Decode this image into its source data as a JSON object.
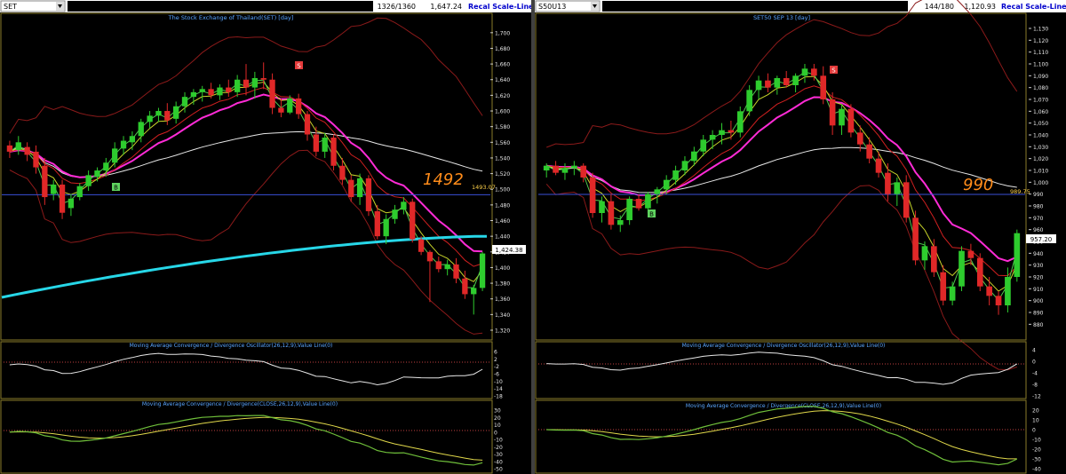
{
  "panels": [
    {
      "id": "left",
      "symbol": "SET",
      "counter": "1326/1360",
      "last_value": "1,647.24",
      "scale_button": "Recal Scale-Linear",
      "main_title": "The Stock Exchange of Thailand(SET) [day]",
      "annotation": "1492",
      "hline_label": "1493.07",
      "last_price_label": "1,424.38",
      "buy_marker": "B",
      "sell_marker": "S",
      "y_ticks": [
        "1,700",
        "1,680",
        "1,660",
        "1,640",
        "1,620",
        "1,600",
        "1,580",
        "1,560",
        "1,540",
        "1,520",
        "1,500",
        "1,480",
        "1,460",
        "1,440",
        "1,420",
        "1,400",
        "1,380",
        "1,360",
        "1,340",
        "1,320"
      ],
      "osc_title": "Moving Average Convergence / Divergence Oscillator(26,12,9),Value Line(0)",
      "osc_ticks": [
        "6",
        "2",
        "-2",
        "-6",
        "-10",
        "-14",
        "-18"
      ],
      "macd_title": "Moving Average Convergence / Divergence(CLOSE,26,12,9),Value Line(0)",
      "macd_ticks": [
        "30",
        "20",
        "10",
        "0",
        "-10",
        "-20",
        "-30",
        "-40",
        "-50"
      ]
    },
    {
      "id": "right",
      "symbol": "S50U13",
      "counter": "144/180",
      "last_value": "1,120.93",
      "scale_button": "Recal Scale-Linear",
      "main_title": "SET50 SEP 13   [day]",
      "annotation": "990",
      "hline_label": "989.75",
      "last_price_label": "957.20",
      "buy_marker": "B",
      "sell_marker": "S",
      "y_ticks": [
        "1,130",
        "1,120",
        "1,110",
        "1,100",
        "1,090",
        "1,080",
        "1,070",
        "1,060",
        "1,050",
        "1,040",
        "1,030",
        "1,020",
        "1,010",
        "1,000",
        "990",
        "980",
        "970",
        "960",
        "950",
        "940",
        "930",
        "920",
        "910",
        "900",
        "890",
        "880"
      ],
      "osc_title": "Moving Average Convergence / Divergence Oscillator(26,12,9),Value Line(0)",
      "osc_ticks": [
        "4",
        "0",
        "-4",
        "-8",
        "-12"
      ],
      "macd_title": "Moving Average Convergence / Divergence(CLOSE,26,12,9),Value Line(0)",
      "macd_ticks": [
        "20",
        "10",
        "0",
        "-10",
        "-20",
        "-30",
        "-40"
      ]
    }
  ],
  "chart_data": [
    {
      "type": "candlestick",
      "title": "The Stock Exchange of Thailand(SET) [day]",
      "ylim": [
        1320,
        1710
      ],
      "hline": 1493.07,
      "last": 1424.38,
      "candles": [
        [
          1556,
          1562,
          1540,
          1548
        ],
        [
          1550,
          1568,
          1544,
          1560
        ],
        [
          1554,
          1560,
          1536,
          1544
        ],
        [
          1548,
          1556,
          1520,
          1528
        ],
        [
          1530,
          1540,
          1480,
          1490
        ],
        [
          1494,
          1512,
          1486,
          1506
        ],
        [
          1506,
          1512,
          1462,
          1470
        ],
        [
          1476,
          1494,
          1466,
          1488
        ],
        [
          1490,
          1508,
          1486,
          1504
        ],
        [
          1504,
          1524,
          1498,
          1518
        ],
        [
          1516,
          1528,
          1510,
          1524
        ],
        [
          1524,
          1540,
          1516,
          1534
        ],
        [
          1534,
          1560,
          1528,
          1552
        ],
        [
          1552,
          1568,
          1544,
          1562
        ],
        [
          1560,
          1574,
          1550,
          1568
        ],
        [
          1568,
          1590,
          1560,
          1586
        ],
        [
          1586,
          1600,
          1578,
          1594
        ],
        [
          1594,
          1604,
          1586,
          1600
        ],
        [
          1600,
          1610,
          1582,
          1588
        ],
        [
          1590,
          1612,
          1584,
          1606
        ],
        [
          1606,
          1624,
          1598,
          1618
        ],
        [
          1618,
          1628,
          1608,
          1624
        ],
        [
          1624,
          1632,
          1612,
          1628
        ],
        [
          1628,
          1636,
          1616,
          1620
        ],
        [
          1620,
          1634,
          1614,
          1630
        ],
        [
          1630,
          1640,
          1618,
          1624
        ],
        [
          1624,
          1646,
          1618,
          1640
        ],
        [
          1640,
          1660,
          1620,
          1630
        ],
        [
          1630,
          1650,
          1616,
          1642
        ],
        [
          1642,
          1662,
          1628,
          1640
        ],
        [
          1640,
          1648,
          1596,
          1604
        ],
        [
          1604,
          1616,
          1592,
          1598
        ],
        [
          1598,
          1620,
          1596,
          1616
        ],
        [
          1616,
          1622,
          1590,
          1596
        ],
        [
          1596,
          1600,
          1562,
          1570
        ],
        [
          1570,
          1580,
          1542,
          1548
        ],
        [
          1548,
          1572,
          1540,
          1566
        ],
        [
          1566,
          1570,
          1524,
          1530
        ],
        [
          1530,
          1540,
          1506,
          1512
        ],
        [
          1512,
          1518,
          1484,
          1490
        ],
        [
          1490,
          1520,
          1480,
          1514
        ],
        [
          1514,
          1518,
          1466,
          1472
        ],
        [
          1472,
          1480,
          1436,
          1440
        ],
        [
          1440,
          1468,
          1430,
          1462
        ],
        [
          1462,
          1480,
          1456,
          1474
        ],
        [
          1474,
          1490,
          1468,
          1484
        ],
        [
          1484,
          1488,
          1432,
          1436
        ],
        [
          1436,
          1440,
          1416,
          1420
        ],
        [
          1420,
          1422,
          1356,
          1408
        ],
        [
          1408,
          1414,
          1394,
          1398
        ],
        [
          1398,
          1410,
          1390,
          1404
        ],
        [
          1404,
          1412,
          1380,
          1386
        ],
        [
          1386,
          1396,
          1360,
          1366
        ],
        [
          1366,
          1378,
          1340,
          1374
        ],
        [
          1374,
          1420,
          1370,
          1418
        ]
      ]
    },
    {
      "type": "candlestick",
      "title": "SET50 SEP 13   [day]",
      "ylim": [
        875,
        1133
      ],
      "hline": 989.75,
      "last": 957.2,
      "candles": [
        [
          1010,
          1016,
          1004,
          1014
        ],
        [
          1014,
          1018,
          1006,
          1008
        ],
        [
          1008,
          1016,
          1002,
          1012
        ],
        [
          1012,
          1018,
          1006,
          1014
        ],
        [
          1014,
          1016,
          1000,
          1004
        ],
        [
          1004,
          1008,
          970,
          974
        ],
        [
          974,
          988,
          966,
          984
        ],
        [
          984,
          990,
          960,
          964
        ],
        [
          964,
          972,
          958,
          968
        ],
        [
          968,
          988,
          964,
          986
        ],
        [
          986,
          990,
          976,
          978
        ],
        [
          978,
          992,
          974,
          990
        ],
        [
          990,
          996,
          982,
          994
        ],
        [
          994,
          1006,
          990,
          1002
        ],
        [
          1002,
          1014,
          998,
          1010
        ],
        [
          1010,
          1022,
          1006,
          1018
        ],
        [
          1018,
          1030,
          1014,
          1026
        ],
        [
          1026,
          1040,
          1022,
          1036
        ],
        [
          1036,
          1044,
          1028,
          1040
        ],
        [
          1040,
          1050,
          1032,
          1044
        ],
        [
          1044,
          1052,
          1036,
          1042
        ],
        [
          1042,
          1064,
          1038,
          1060
        ],
        [
          1060,
          1082,
          1056,
          1078
        ],
        [
          1078,
          1090,
          1070,
          1086
        ],
        [
          1086,
          1092,
          1076,
          1080
        ],
        [
          1080,
          1090,
          1074,
          1088
        ],
        [
          1088,
          1094,
          1080,
          1082
        ],
        [
          1082,
          1092,
          1076,
          1090
        ],
        [
          1090,
          1100,
          1084,
          1096
        ],
        [
          1096,
          1100,
          1086,
          1090
        ],
        [
          1090,
          1098,
          1066,
          1070
        ],
        [
          1070,
          1076,
          1040,
          1048
        ],
        [
          1048,
          1066,
          1040,
          1062
        ],
        [
          1062,
          1066,
          1038,
          1042
        ],
        [
          1042,
          1048,
          1026,
          1032
        ],
        [
          1032,
          1038,
          1016,
          1020
        ],
        [
          1020,
          1026,
          1004,
          1008
        ],
        [
          1008,
          1016,
          984,
          990
        ],
        [
          990,
          1004,
          980,
          1000
        ],
        [
          1000,
          1006,
          966,
          970
        ],
        [
          970,
          976,
          930,
          934
        ],
        [
          934,
          950,
          926,
          946
        ],
        [
          946,
          952,
          920,
          924
        ],
        [
          924,
          930,
          896,
          900
        ],
        [
          900,
          916,
          896,
          912
        ],
        [
          912,
          946,
          908,
          942
        ],
        [
          942,
          948,
          930,
          936
        ],
        [
          936,
          940,
          908,
          912
        ],
        [
          912,
          920,
          896,
          904
        ],
        [
          904,
          908,
          888,
          896
        ],
        [
          896,
          928,
          890,
          920
        ],
        [
          920,
          960,
          916,
          957
        ]
      ]
    }
  ]
}
